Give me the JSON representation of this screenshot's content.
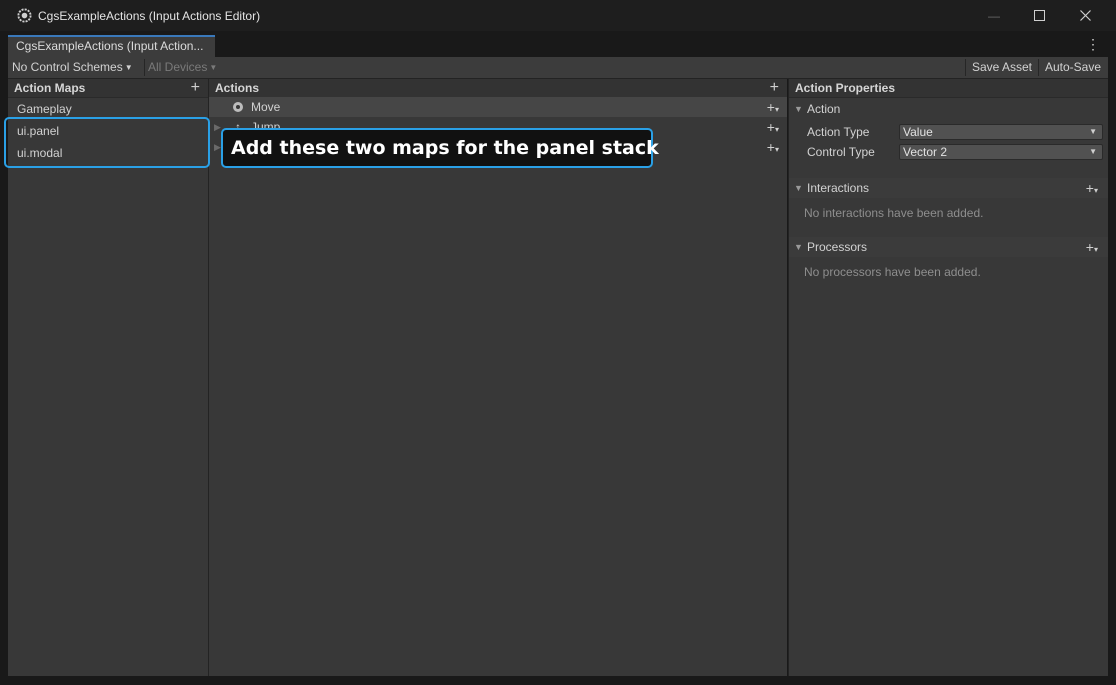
{
  "window": {
    "title": "CgsExampleActions (Input Actions Editor)",
    "minimize_glyph": "—",
    "maximize_glyph": "☐",
    "close_glyph": "✕"
  },
  "tab": {
    "label": "CgsExampleActions (Input Action..."
  },
  "toolbar": {
    "control_schemes": "No Control Schemes",
    "devices": "All Devices",
    "save_asset": "Save Asset",
    "auto_save": "Auto-Save"
  },
  "action_maps": {
    "header": "Action Maps",
    "items": [
      {
        "label": "Gameplay"
      },
      {
        "label": "ui.panel"
      },
      {
        "label": "ui.modal"
      }
    ]
  },
  "actions": {
    "header": "Actions",
    "items": [
      {
        "label": "Move",
        "selected": true
      },
      {
        "label": "Jump",
        "selected": false
      },
      {
        "label": "",
        "selected": false
      }
    ]
  },
  "properties": {
    "header": "Action Properties",
    "action_section": "Action",
    "action_type_label": "Action Type",
    "action_type_value": "Value",
    "control_type_label": "Control Type",
    "control_type_value": "Vector 2",
    "interactions_section": "Interactions",
    "interactions_empty": "No interactions have been added.",
    "processors_section": "Processors",
    "processors_empty": "No processors have been added."
  },
  "annotation": {
    "text": "Add these two maps for the panel stack",
    "accent_color": "#2aa0e6"
  },
  "icons": {
    "app": "unity-gear-icon",
    "add": "plus-icon",
    "add_binding": "plus-dropdown-icon",
    "kebab": "kebab-menu-icon",
    "fold": "triangle-fold-icon"
  }
}
